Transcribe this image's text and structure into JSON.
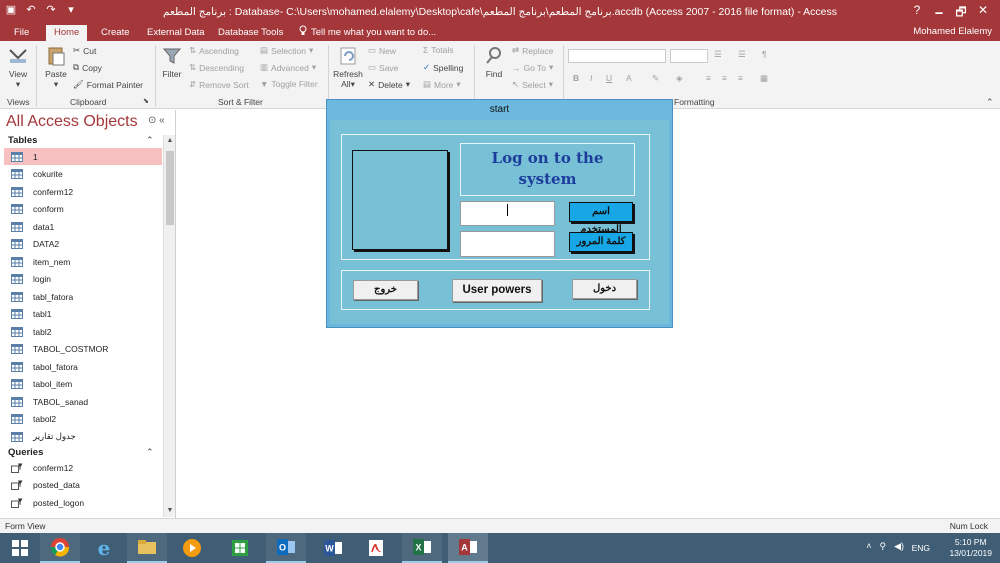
{
  "window": {
    "title": "برنامج المطعم : Database- C:\\Users\\mohamed.elalemy\\Desktop\\cafe\\برنامج المطعم\\برنامج المطعم.accdb (Access 2007 - 2016 file format) - Access",
    "help": "?",
    "minimize": "🗕",
    "restore": "🗗",
    "close": "✕"
  },
  "ribbon_tabs": [
    "File",
    "Home",
    "Create",
    "External Data",
    "Database Tools"
  ],
  "tell_me": "Tell me what you want to do...",
  "user_name": "Mohamed Elalemy",
  "ribbon": {
    "views": {
      "view_label": "View",
      "group": "Views"
    },
    "clipboard": {
      "paste": "Paste",
      "cut": "Cut",
      "copy": "Copy",
      "format_painter": "Format Painter",
      "group": "Clipboard"
    },
    "sort_filter": {
      "filter": "Filter",
      "ascending": "Ascending",
      "descending": "Descending",
      "remove_sort": "Remove Sort",
      "selection": "Selection",
      "advanced": "Advanced",
      "toggle_filter": "Toggle Filter",
      "group": "Sort & Filter"
    },
    "records": {
      "refresh": "Refresh",
      "refresh_sub": "All",
      "new": "New",
      "save": "Save",
      "delete": "Delete",
      "totals": "Totals",
      "spelling": "Spelling",
      "more": "More"
    },
    "find": {
      "find": "Find",
      "replace": "Replace",
      "goto": "Go To",
      "select": "Select"
    },
    "text_formatting": {
      "bold": "B",
      "italic": "I",
      "underline": "U",
      "group": "Formatting"
    }
  },
  "nav": {
    "title": "All Access Objects",
    "sections": {
      "tables": "Tables",
      "queries": "Queries"
    },
    "tables": [
      "1",
      "cokurite",
      "conferm12",
      "conform",
      "data1",
      "DATA2",
      "item_nem",
      "login",
      "tabl_fatora",
      "tabl1",
      "tabl2",
      "TABOL_COSTMOR",
      "tabol_fatora",
      "tabol_item",
      "TABOL_sanad",
      "tabol2",
      "جدول تقارير"
    ],
    "queries": [
      "conferm12",
      "posted_data",
      "posted_logon"
    ]
  },
  "form": {
    "title": "start",
    "headline": "Log on to the system",
    "username_label": "اسم المستخدم",
    "password_label": "كلمة المرور",
    "username_value": "",
    "password_value": "",
    "exit_button": "خروج",
    "user_powers_button": "User powers",
    "enter_button": "دخول"
  },
  "status": {
    "left": "Form View",
    "right": "Num Lock"
  },
  "tray": {
    "language": "ENG",
    "time": "5:10 PM",
    "date": "13/01/2019"
  },
  "colors": {
    "access_red": "#a4373a",
    "form_blue": "#6ab7dd",
    "label_blue": "#17a7e6",
    "headline_blue": "#1d3d9c"
  }
}
